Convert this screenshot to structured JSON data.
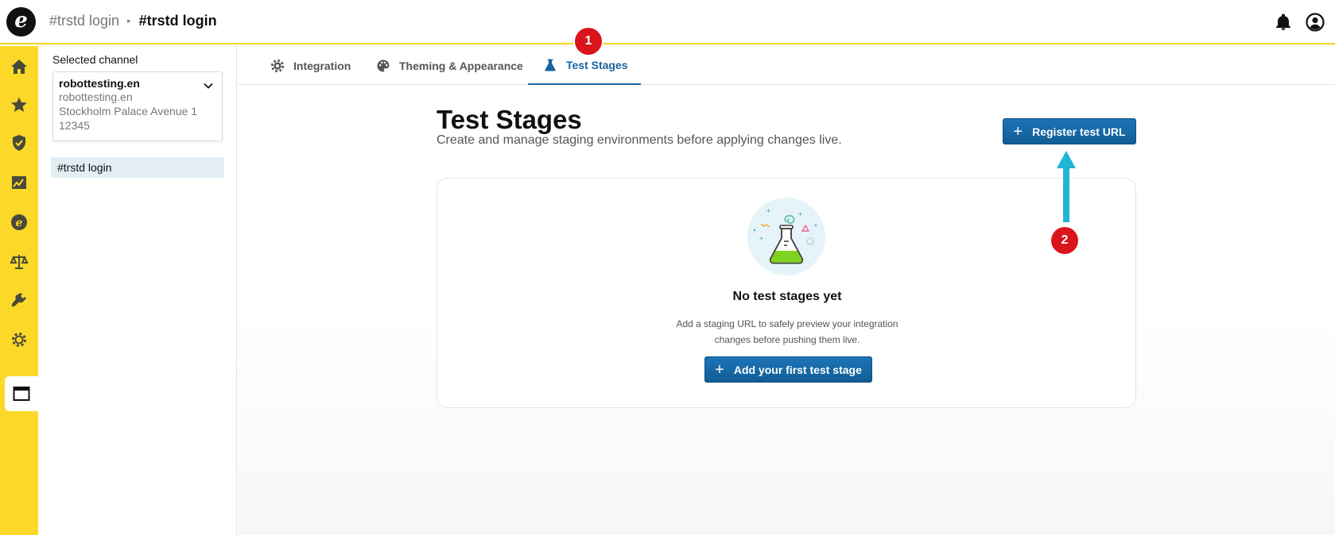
{
  "header": {
    "logo_letter": "e",
    "breadcrumb_1": "#trstd login",
    "breadcrumb_sep": "▸",
    "breadcrumb_2": "#trstd login",
    "icons": [
      "bell-icon",
      "user-circle-icon"
    ]
  },
  "rail": {
    "items": [
      "home-icon",
      "star-icon",
      "shield-check-icon",
      "chart-icon",
      "etrusted-icon",
      "scale-icon",
      "plug-icon",
      "gear-icon",
      "browser-window-icon"
    ],
    "active": "browser-window-icon"
  },
  "channel_panel": {
    "label": "Selected channel",
    "channel_name": "robottesting.en",
    "channel_domain": "robottesting.en",
    "channel_address": "Stockholm Palace Avenue 1",
    "channel_zip": "12345",
    "selected_item": "#trstd login"
  },
  "tabs": [
    {
      "label": "Integration",
      "icon": "gear-icon"
    },
    {
      "label": "Theming & Appearance",
      "icon": "palette-icon"
    },
    {
      "label": "Test Stages",
      "icon": "flask-icon",
      "active": true
    }
  ],
  "main": {
    "title": "Test Stages",
    "subtitle": "Create and manage staging environments before applying changes live.",
    "register_button": "Register test URL",
    "plus": "+",
    "empty_title": "No test stages yet",
    "empty_line_1": "Add a staging URL to safely preview your integration",
    "empty_line_2": "changes before pushing them live.",
    "first_button": "Add your first test stage"
  },
  "annotations": {
    "badge_1": "1",
    "badge_2": "2"
  },
  "colors": {
    "accent_yellow": "#fcd928",
    "primary_blue": "#1764a0",
    "badge_red": "#d9141b",
    "arrow_cyan": "#1fb5d6"
  }
}
